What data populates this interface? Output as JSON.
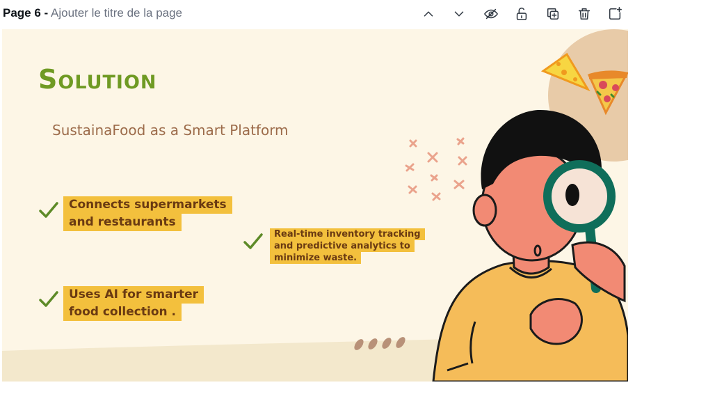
{
  "topbar": {
    "page_number": "Page 6 -",
    "page_title_placeholder": "Ajouter le titre de la page",
    "icons": [
      "chevron-up-icon",
      "chevron-down-icon",
      "eye-slash-icon",
      "unlock-icon",
      "duplicate-icon",
      "trash-icon",
      "add-page-icon"
    ]
  },
  "slide": {
    "title": "Solution",
    "subtitle": "SustainaFood as a Smart Platform",
    "bullets": [
      {
        "lines": [
          "Connects supermarkets",
          "and restaurants"
        ]
      },
      {
        "lines": [
          "Real-time inventory tracking",
          "and predictive analytics to",
          "minimize waste."
        ]
      },
      {
        "lines": [
          "Uses AI for smarter",
          "food collection ."
        ]
      }
    ],
    "colors": {
      "background": "#fdf6e6",
      "title": "#6f9a23",
      "subtitle": "#9c6b4a",
      "highlight": "#f3c03d",
      "highlight_text": "#6a3a12",
      "check": "#5d8a27"
    }
  }
}
